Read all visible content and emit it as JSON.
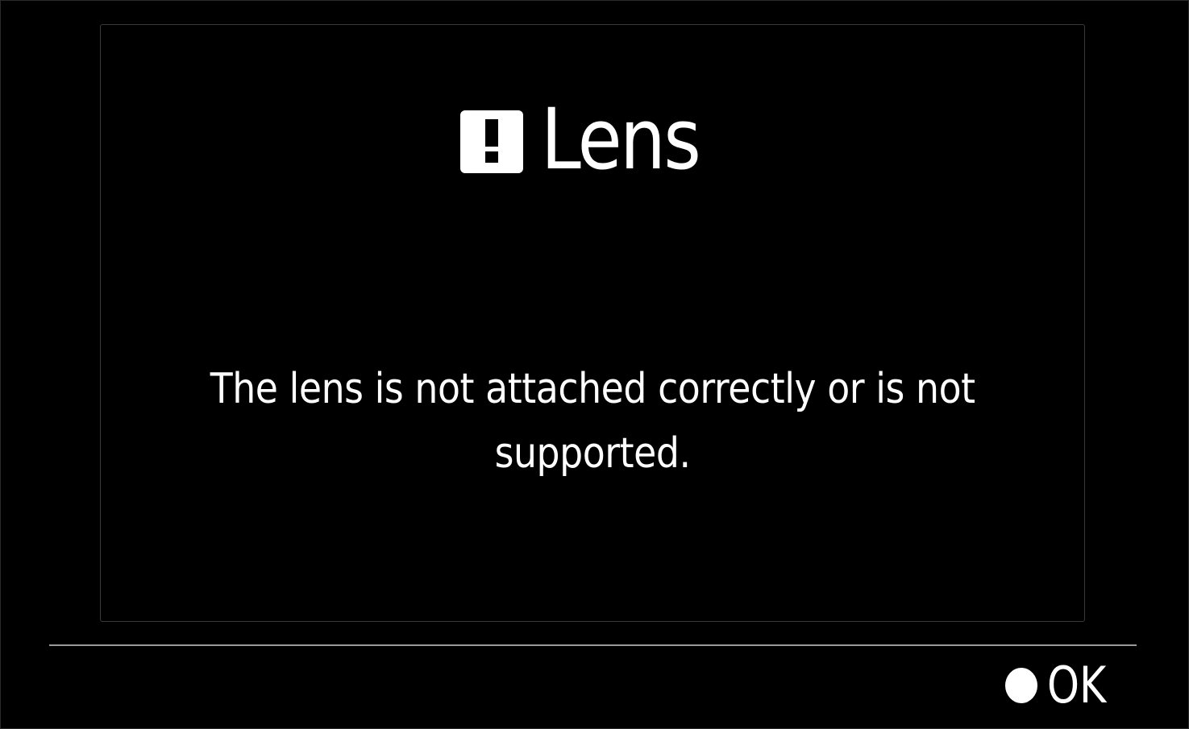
{
  "dialog": {
    "title": "Lens",
    "title_icon": "warning-exclamation-icon",
    "message_line1": "The lens is not attached correctly or is not",
    "message_line2": "supported."
  },
  "footer": {
    "ok_icon": "filled-circle-button-icon",
    "ok_label": "OK"
  },
  "colors": {
    "background": "#000000",
    "text": "#ffffff",
    "divider": "#9a9a9a"
  }
}
